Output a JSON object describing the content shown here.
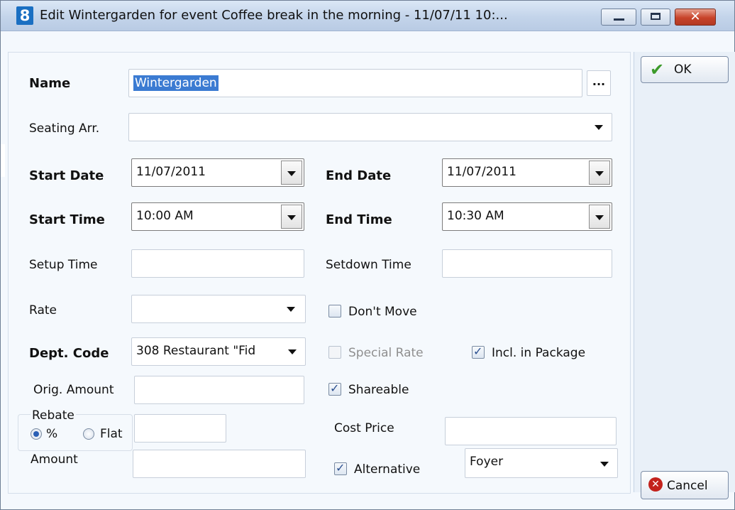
{
  "window": {
    "title": "Edit Wintergarden for event Coffee break in the morning - 11/07/11 10:...",
    "app_icon": "8"
  },
  "form": {
    "name_label": "Name",
    "name_value": "Wintergarden",
    "ellipsis_label": "...",
    "seating_label": "Seating Arr.",
    "seating_value": "",
    "start_date_label": "Start Date",
    "start_date_value": "11/07/2011",
    "end_date_label": "End Date",
    "end_date_value": "11/07/2011",
    "start_time_label": "Start Time",
    "start_time_value": "10:00 AM",
    "end_time_label": "End Time",
    "end_time_value": "10:30 AM",
    "setup_time_label": "Setup Time",
    "setup_time_value": "",
    "setdown_time_label": "Setdown Time",
    "setdown_time_value": "",
    "rate_label": "Rate",
    "rate_value": "",
    "dont_move_label": "Don't Move",
    "dont_move_checked": false,
    "dept_code_label": "Dept. Code",
    "dept_code_value": "308  Restaurant \"Fid",
    "special_rate_label": "Special Rate",
    "special_rate_checked": false,
    "incl_package_label": "Incl. in Package",
    "incl_package_checked": true,
    "orig_amount_label": "Orig. Amount",
    "orig_amount_value": "",
    "shareable_label": "Shareable",
    "shareable_checked": true,
    "rebate_label": "Rebate",
    "rebate_percent_label": "%",
    "rebate_flat_label": "Flat",
    "rebate_mode": "%",
    "rebate_value": "",
    "cost_price_label": "Cost Price",
    "cost_price_value": "",
    "amount_label": "Amount",
    "amount_value": "",
    "alternative_label": "Alternative",
    "alternative_checked": true,
    "alternative_value": "Foyer"
  },
  "buttons": {
    "ok": "OK",
    "cancel": "Cancel"
  },
  "colors": {
    "titlebar": "#c3d4ea",
    "selection": "#3b7bd2",
    "close_button": "#c7432a",
    "ok_check": "#3c9a2a",
    "cancel_icon": "#c3221c"
  }
}
